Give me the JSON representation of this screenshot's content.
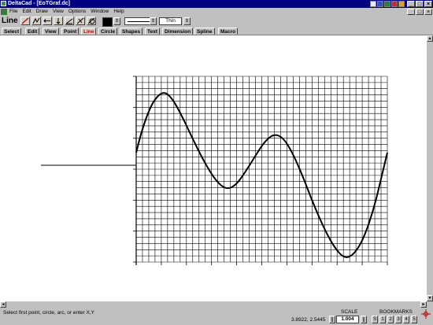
{
  "window": {
    "title": "DeltaCad - [EoTGraf.dc]",
    "min_label": "_",
    "max_label": "□",
    "close_label": "×"
  },
  "menu": [
    "File",
    "Edit",
    "Draw",
    "View",
    "Options",
    "Window",
    "Help"
  ],
  "toolbar": {
    "mode_label": "Line",
    "thickness": "Thin",
    "color": "#000000",
    "dropdown_arrow": "⇕"
  },
  "tabs": [
    "Select",
    "Edit",
    "View",
    "Point",
    "Line",
    "Circle",
    "Shapes",
    "Text",
    "Dimension",
    "Spline",
    "Macro"
  ],
  "active_tab": "Line",
  "status": {
    "prompt": "Select first point, circle, arc, or enter X,Y",
    "coordinates": "3.8922, 2.5445",
    "scale_label": "SCALE",
    "scale_value": "1.004",
    "bookmarks_label": "BOOKMARKS",
    "bookmarks": [
      "S",
      "1",
      "2",
      "3",
      "4",
      "5"
    ]
  },
  "scroll": {
    "up": "▲",
    "down": "▼",
    "left": "◄",
    "right": "►"
  }
}
